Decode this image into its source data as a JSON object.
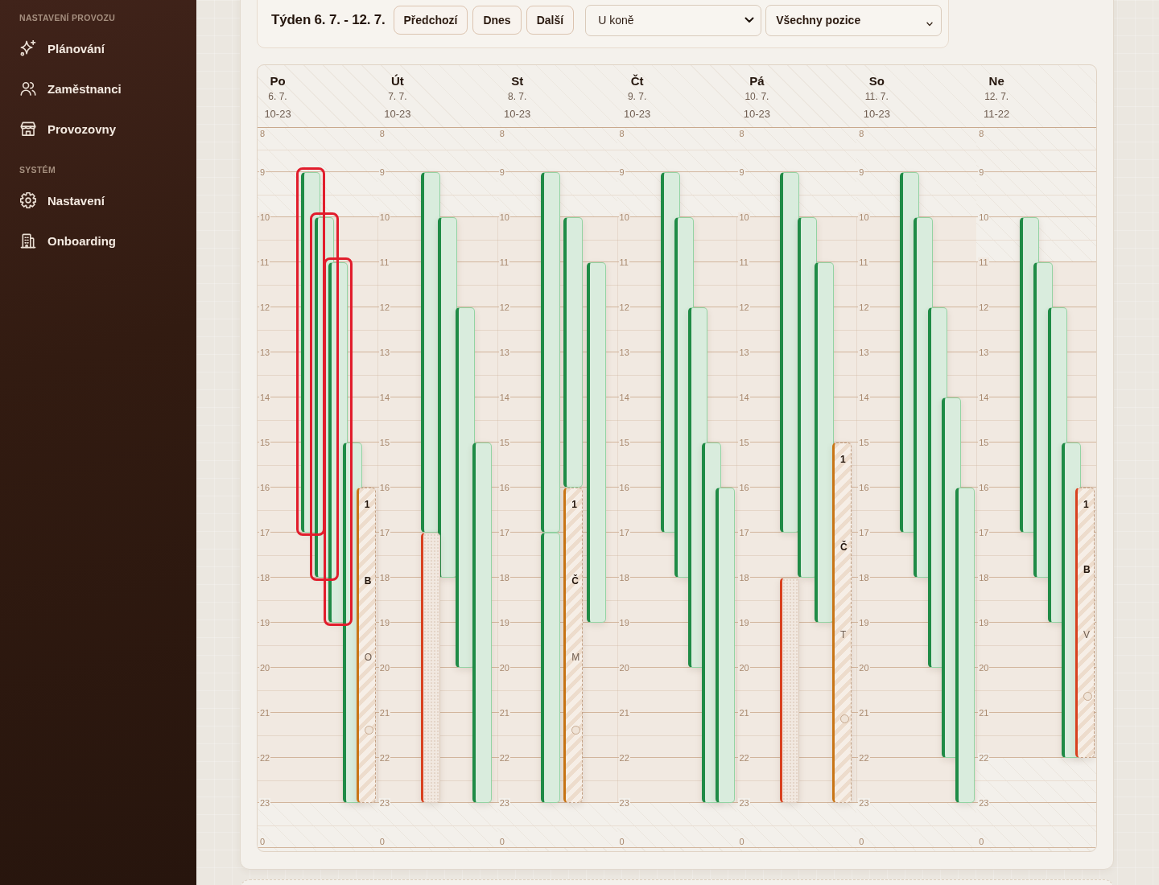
{
  "sidebar": {
    "sections": [
      {
        "heading": "NASTAVENÍ PROVOZU",
        "items": [
          {
            "label": "Plánování"
          },
          {
            "label": "Zaměstnanci"
          },
          {
            "label": "Provozovny"
          }
        ]
      },
      {
        "heading": "SYSTÉM",
        "items": [
          {
            "label": "Nastavení"
          },
          {
            "label": "Onboarding"
          }
        ]
      }
    ]
  },
  "toolbar": {
    "title": "Týden 6. 7. - 12. 7.",
    "buttons": [
      "Předchozí",
      "Dnes",
      "Další"
    ],
    "location_select": {
      "value": "U koně"
    },
    "position_select": {
      "value": "Všechny pozice"
    }
  },
  "days": [
    {
      "name": "Po",
      "date": "6. 7.",
      "hours": "10-23",
      "rows": [
        {
          "label": "8"
        },
        {
          "label": "9",
          "shifts": [
            {
              "kind": "assigned",
              "color": "#1f8b46",
              "highlighted": true,
              "slots": [
                {
                  "kind": "hour"
                },
                {
                  "kind": "hour"
                },
                {
                  "kind": "hour"
                },
                {
                  "kind": "hour"
                },
                {
                  "kind": "hour"
                },
                {
                  "kind": "hour"
                },
                {
                  "kind": "hour"
                },
                {
                  "kind": "hour"
                }
              ]
            }
          ]
        },
        {
          "label": "10",
          "shifts": [
            {
              "kind": "assigned",
              "color": "#1f8b46",
              "highlighted": true,
              "slots": [
                {
                  "kind": "hour"
                },
                {
                  "kind": "hour"
                },
                {
                  "kind": "hour"
                },
                {
                  "kind": "hour"
                },
                {
                  "kind": "hour"
                },
                {
                  "kind": "hour"
                },
                {
                  "kind": "hour"
                },
                {
                  "kind": "hour"
                }
              ]
            }
          ]
        },
        {
          "label": "11",
          "shifts": [
            {
              "kind": "assigned",
              "color": "#1f8b46",
              "highlighted": true,
              "slots": [
                {
                  "kind": "hour"
                },
                {
                  "kind": "hour"
                },
                {
                  "kind": "hour"
                },
                {
                  "kind": "hour"
                },
                {
                  "kind": "hour"
                },
                {
                  "kind": "hour"
                },
                {
                  "kind": "hour"
                },
                {
                  "kind": "hour"
                }
              ]
            }
          ]
        },
        {
          "label": "12"
        },
        {
          "label": "13"
        },
        {
          "label": "14"
        },
        {
          "label": "15",
          "shifts": [
            {
              "kind": "assigned",
              "color": "#1f8b46",
              "highlighted": false,
              "slots": [
                {
                  "kind": "hour"
                },
                {
                  "kind": "hour"
                },
                {
                  "kind": "hour"
                },
                {
                  "kind": "hour"
                },
                {
                  "kind": "hour"
                },
                {
                  "kind": "hour"
                },
                {
                  "kind": "hour"
                },
                {
                  "kind": "hour"
                }
              ]
            }
          ]
        },
        {
          "label": "16",
          "shifts": [
            {
              "kind": "open",
              "color": "#c97516",
              "highlighted": false,
              "slots": [
                {
                  "kind": "hour"
                },
                {
                  "kind": "hour"
                },
                {
                  "kind": "hour"
                },
                {
                  "kind": "hour"
                },
                {
                  "kind": "hour"
                },
                {
                  "kind": "hour"
                },
                {
                  "kind": "hour"
                }
              ],
              "time": "1",
              "title": "B",
              "subtitle": "O"
            }
          ]
        },
        {
          "label": "17"
        },
        {
          "label": "18"
        },
        {
          "label": "19"
        },
        {
          "label": "20"
        },
        {
          "label": "21"
        },
        {
          "label": "22"
        },
        {
          "label": "23"
        },
        {
          "label": "0"
        }
      ]
    },
    {
      "name": "Út",
      "date": "7. 7.",
      "hours": "10-23",
      "rows": [
        {
          "label": "8"
        },
        {
          "label": "9",
          "shifts": [
            {
              "kind": "assigned",
              "color": "#1f8b46",
              "highlighted": false,
              "slots": [
                {
                  "kind": "hour"
                },
                {
                  "kind": "hour"
                },
                {
                  "kind": "hour"
                },
                {
                  "kind": "hour"
                },
                {
                  "kind": "hour"
                },
                {
                  "kind": "hour"
                },
                {
                  "kind": "hour"
                },
                {
                  "kind": "hour"
                }
              ]
            }
          ]
        },
        {
          "label": "10",
          "shifts": [
            {
              "kind": "assigned",
              "color": "#1f8b46",
              "highlighted": false,
              "slots": [
                {
                  "kind": "hour"
                },
                {
                  "kind": "hour"
                },
                {
                  "kind": "hour"
                },
                {
                  "kind": "hour"
                },
                {
                  "kind": "hour"
                },
                {
                  "kind": "hour"
                },
                {
                  "kind": "hour"
                },
                {
                  "kind": "hour"
                }
              ]
            }
          ]
        },
        {
          "label": "11"
        },
        {
          "label": "12",
          "shifts": [
            {
              "kind": "assigned",
              "color": "#1f8b46",
              "highlighted": false,
              "slots": [
                {
                  "kind": "hour"
                },
                {
                  "kind": "hour"
                },
                {
                  "kind": "hour"
                },
                {
                  "kind": "hour"
                },
                {
                  "kind": "hour"
                },
                {
                  "kind": "hour"
                },
                {
                  "kind": "hour"
                },
                {
                  "kind": "hour"
                }
              ]
            }
          ]
        },
        {
          "label": "13"
        },
        {
          "label": "14"
        },
        {
          "label": "15",
          "shifts": [
            {
              "kind": "assigned",
              "color": "#1f8b46",
              "highlighted": false,
              "slots": [
                {
                  "kind": "hour"
                },
                {
                  "kind": "hour"
                },
                {
                  "kind": "hour"
                },
                {
                  "kind": "hour"
                },
                {
                  "kind": "hour"
                },
                {
                  "kind": "hour"
                },
                {
                  "kind": "hour"
                },
                {
                  "kind": "hour"
                }
              ]
            }
          ]
        },
        {
          "label": "16"
        },
        {
          "label": "17",
          "shifts": [
            {
              "kind": "unassigned",
              "color": "#d8411f",
              "highlighted": false,
              "slots": [
                {
                  "kind": "hour"
                },
                {
                  "kind": "hour"
                },
                {
                  "kind": "hour"
                },
                {
                  "kind": "hour"
                },
                {
                  "kind": "hour"
                },
                {
                  "kind": "hour"
                }
              ]
            }
          ]
        },
        {
          "label": "18"
        },
        {
          "label": "19"
        },
        {
          "label": "20"
        },
        {
          "label": "21"
        },
        {
          "label": "22"
        },
        {
          "label": "23"
        },
        {
          "label": "0"
        }
      ]
    },
    {
      "name": "St",
      "date": "8. 7.",
      "hours": "10-23",
      "rows": [
        {
          "label": "8"
        },
        {
          "label": "9",
          "shifts": [
            {
              "kind": "assigned",
              "color": "#1f8b46",
              "highlighted": false,
              "slots": [
                {
                  "kind": "hour"
                },
                {
                  "kind": "hour"
                },
                {
                  "kind": "hour"
                },
                {
                  "kind": "hour"
                },
                {
                  "kind": "hour"
                },
                {
                  "kind": "hour"
                },
                {
                  "kind": "hour"
                },
                {
                  "kind": "hour"
                }
              ]
            }
          ]
        },
        {
          "label": "10",
          "shifts": [
            {
              "kind": "assigned",
              "color": "#1f8b46",
              "highlighted": false,
              "slots": [
                {
                  "kind": "hour"
                },
                {
                  "kind": "hour"
                },
                {
                  "kind": "hour"
                },
                {
                  "kind": "hour"
                },
                {
                  "kind": "hour"
                },
                {
                  "kind": "hour"
                }
              ]
            }
          ]
        },
        {
          "label": "11",
          "shifts": [
            {
              "kind": "assigned",
              "color": "#1f8b46",
              "highlighted": false,
              "slots": [
                {
                  "kind": "hour"
                },
                {
                  "kind": "hour"
                },
                {
                  "kind": "hour"
                },
                {
                  "kind": "hour"
                },
                {
                  "kind": "hour"
                },
                {
                  "kind": "hour"
                },
                {
                  "kind": "hour"
                },
                {
                  "kind": "hour"
                }
              ]
            }
          ]
        },
        {
          "label": "12"
        },
        {
          "label": "13"
        },
        {
          "label": "14"
        },
        {
          "label": "15"
        },
        {
          "label": "16",
          "shifts": [
            {
              "kind": "open",
              "color": "#c97516",
              "highlighted": false,
              "slots": [
                {
                  "kind": "hour"
                },
                {
                  "kind": "hour"
                },
                {
                  "kind": "hour"
                },
                {
                  "kind": "hour"
                },
                {
                  "kind": "hour"
                },
                {
                  "kind": "hour"
                },
                {
                  "kind": "hour"
                }
              ],
              "time": "1",
              "title": "Č",
              "subtitle": "M"
            }
          ]
        },
        {
          "label": "17",
          "shifts": [
            {
              "kind": "assigned",
              "color": "#1f8b46",
              "highlighted": false,
              "slots": [
                {
                  "kind": "hour"
                },
                {
                  "kind": "hour"
                },
                {
                  "kind": "hour"
                },
                {
                  "kind": "hour"
                },
                {
                  "kind": "hour"
                },
                {
                  "kind": "hour"
                }
              ]
            }
          ]
        },
        {
          "label": "18"
        },
        {
          "label": "19"
        },
        {
          "label": "20"
        },
        {
          "label": "21"
        },
        {
          "label": "22"
        },
        {
          "label": "23"
        },
        {
          "label": "0"
        }
      ]
    },
    {
      "name": "Čt",
      "date": "9. 7.",
      "hours": "10-23",
      "rows": [
        {
          "label": "8"
        },
        {
          "label": "9",
          "shifts": [
            {
              "kind": "assigned",
              "color": "#1f8b46",
              "highlighted": false,
              "slots": [
                {
                  "kind": "hour"
                },
                {
                  "kind": "hour"
                },
                {
                  "kind": "hour"
                },
                {
                  "kind": "hour"
                },
                {
                  "kind": "hour"
                },
                {
                  "kind": "hour"
                },
                {
                  "kind": "hour"
                },
                {
                  "kind": "hour"
                }
              ]
            }
          ]
        },
        {
          "label": "10",
          "shifts": [
            {
              "kind": "assigned",
              "color": "#1f8b46",
              "highlighted": false,
              "slots": [
                {
                  "kind": "hour"
                },
                {
                  "kind": "hour"
                },
                {
                  "kind": "hour"
                },
                {
                  "kind": "hour"
                },
                {
                  "kind": "hour"
                },
                {
                  "kind": "hour"
                },
                {
                  "kind": "hour"
                },
                {
                  "kind": "hour"
                }
              ]
            }
          ]
        },
        {
          "label": "11"
        },
        {
          "label": "12",
          "shifts": [
            {
              "kind": "assigned",
              "color": "#1f8b46",
              "highlighted": false,
              "slots": [
                {
                  "kind": "hour"
                },
                {
                  "kind": "hour"
                },
                {
                  "kind": "hour"
                },
                {
                  "kind": "hour"
                },
                {
                  "kind": "hour"
                },
                {
                  "kind": "hour"
                },
                {
                  "kind": "hour"
                },
                {
                  "kind": "hour"
                }
              ]
            }
          ]
        },
        {
          "label": "13"
        },
        {
          "label": "14"
        },
        {
          "label": "15",
          "shifts": [
            {
              "kind": "assigned",
              "color": "#1f8b46",
              "highlighted": false,
              "slots": [
                {
                  "kind": "hour"
                },
                {
                  "kind": "hour"
                },
                {
                  "kind": "hour"
                },
                {
                  "kind": "hour"
                },
                {
                  "kind": "hour"
                },
                {
                  "kind": "hour"
                },
                {
                  "kind": "hour"
                },
                {
                  "kind": "hour"
                }
              ]
            }
          ]
        },
        {
          "label": "16",
          "shifts": [
            {
              "kind": "assigned",
              "color": "#1f8b46",
              "highlighted": false,
              "slots": [
                {
                  "kind": "hour"
                },
                {
                  "kind": "hour"
                },
                {
                  "kind": "hour"
                },
                {
                  "kind": "hour"
                },
                {
                  "kind": "hour"
                },
                {
                  "kind": "hour"
                },
                {
                  "kind": "hour"
                }
              ]
            }
          ]
        },
        {
          "label": "17"
        },
        {
          "label": "18"
        },
        {
          "label": "19"
        },
        {
          "label": "20"
        },
        {
          "label": "21"
        },
        {
          "label": "22"
        },
        {
          "label": "23"
        },
        {
          "label": "0"
        }
      ]
    },
    {
      "name": "Pá",
      "date": "10. 7.",
      "hours": "10-23",
      "rows": [
        {
          "label": "8"
        },
        {
          "label": "9",
          "shifts": [
            {
              "kind": "assigned",
              "color": "#1f8b46",
              "highlighted": false,
              "slots": [
                {
                  "kind": "hour"
                },
                {
                  "kind": "hour"
                },
                {
                  "kind": "hour"
                },
                {
                  "kind": "hour"
                },
                {
                  "kind": "hour"
                },
                {
                  "kind": "hour"
                },
                {
                  "kind": "hour"
                },
                {
                  "kind": "hour"
                }
              ]
            }
          ]
        },
        {
          "label": "10",
          "shifts": [
            {
              "kind": "assigned",
              "color": "#1f8b46",
              "highlighted": false,
              "slots": [
                {
                  "kind": "hour"
                },
                {
                  "kind": "hour"
                },
                {
                  "kind": "hour"
                },
                {
                  "kind": "hour"
                },
                {
                  "kind": "hour"
                },
                {
                  "kind": "hour"
                },
                {
                  "kind": "hour"
                },
                {
                  "kind": "hour"
                }
              ]
            }
          ]
        },
        {
          "label": "11",
          "shifts": [
            {
              "kind": "assigned",
              "color": "#1f8b46",
              "highlighted": false,
              "slots": [
                {
                  "kind": "hour"
                },
                {
                  "kind": "hour"
                },
                {
                  "kind": "hour"
                },
                {
                  "kind": "hour"
                },
                {
                  "kind": "hour"
                },
                {
                  "kind": "hour"
                },
                {
                  "kind": "hour"
                },
                {
                  "kind": "hour"
                }
              ]
            }
          ]
        },
        {
          "label": "12"
        },
        {
          "label": "13"
        },
        {
          "label": "14"
        },
        {
          "label": "15",
          "shifts": [
            {
              "kind": "open",
              "color": "#c97516",
              "highlighted": false,
              "slots": [
                {
                  "kind": "hour"
                },
                {
                  "kind": "hour"
                },
                {
                  "kind": "hour"
                },
                {
                  "kind": "hour"
                },
                {
                  "kind": "hour"
                },
                {
                  "kind": "hour"
                },
                {
                  "kind": "hour"
                },
                {
                  "kind": "hour"
                }
              ],
              "time": "1",
              "title": "Č",
              "subtitle": "T"
            }
          ]
        },
        {
          "label": "16"
        },
        {
          "label": "17"
        },
        {
          "label": "18",
          "shifts": [
            {
              "kind": "unassigned",
              "color": "#d8411f",
              "highlighted": false,
              "slots": [
                {
                  "kind": "hour"
                },
                {
                  "kind": "hour"
                },
                {
                  "kind": "hour"
                },
                {
                  "kind": "hour"
                },
                {
                  "kind": "hour"
                }
              ]
            }
          ]
        },
        {
          "label": "19"
        },
        {
          "label": "20"
        },
        {
          "label": "21"
        },
        {
          "label": "22"
        },
        {
          "label": "23"
        },
        {
          "label": "0"
        }
      ]
    },
    {
      "name": "So",
      "date": "11. 7.",
      "hours": "10-23",
      "rows": [
        {
          "label": "8"
        },
        {
          "label": "9",
          "shifts": [
            {
              "kind": "assigned",
              "color": "#1f8b46",
              "highlighted": false,
              "slots": [
                {
                  "kind": "hour"
                },
                {
                  "kind": "hour"
                },
                {
                  "kind": "hour"
                },
                {
                  "kind": "hour"
                },
                {
                  "kind": "hour"
                },
                {
                  "kind": "hour"
                },
                {
                  "kind": "hour"
                },
                {
                  "kind": "hour"
                }
              ]
            }
          ]
        },
        {
          "label": "10",
          "shifts": [
            {
              "kind": "assigned",
              "color": "#1f8b46",
              "highlighted": false,
              "slots": [
                {
                  "kind": "hour"
                },
                {
                  "kind": "hour"
                },
                {
                  "kind": "hour"
                },
                {
                  "kind": "hour"
                },
                {
                  "kind": "hour"
                },
                {
                  "kind": "hour"
                },
                {
                  "kind": "hour"
                },
                {
                  "kind": "hour"
                }
              ]
            }
          ]
        },
        {
          "label": "11"
        },
        {
          "label": "12",
          "shifts": [
            {
              "kind": "assigned",
              "color": "#1f8b46",
              "highlighted": false,
              "slots": [
                {
                  "kind": "hour"
                },
                {
                  "kind": "hour"
                },
                {
                  "kind": "hour"
                },
                {
                  "kind": "hour"
                },
                {
                  "kind": "hour"
                },
                {
                  "kind": "hour"
                },
                {
                  "kind": "hour"
                },
                {
                  "kind": "hour"
                }
              ]
            }
          ]
        },
        {
          "label": "13"
        },
        {
          "label": "14",
          "shifts": [
            {
              "kind": "assigned",
              "color": "#1f8b46",
              "highlighted": false,
              "slots": [
                {
                  "kind": "hour"
                },
                {
                  "kind": "hour"
                },
                {
                  "kind": "hour"
                },
                {
                  "kind": "hour"
                },
                {
                  "kind": "hour"
                },
                {
                  "kind": "hour"
                },
                {
                  "kind": "hour"
                },
                {
                  "kind": "hour"
                }
              ]
            }
          ]
        },
        {
          "label": "15"
        },
        {
          "label": "16",
          "shifts": [
            {
              "kind": "assigned",
              "color": "#1f8b46",
              "highlighted": false,
              "slots": [
                {
                  "kind": "hour"
                },
                {
                  "kind": "hour"
                },
                {
                  "kind": "hour"
                },
                {
                  "kind": "hour"
                },
                {
                  "kind": "hour"
                },
                {
                  "kind": "hour"
                },
                {
                  "kind": "hour"
                }
              ]
            }
          ]
        },
        {
          "label": "17"
        },
        {
          "label": "18"
        },
        {
          "label": "19"
        },
        {
          "label": "20"
        },
        {
          "label": "21"
        },
        {
          "label": "22"
        },
        {
          "label": "23"
        },
        {
          "label": "0"
        }
      ]
    },
    {
      "name": "Ne",
      "date": "12. 7.",
      "hours": "11-22",
      "rows": [
        {
          "label": "8"
        },
        {
          "label": "9"
        },
        {
          "label": "10",
          "shifts": [
            {
              "kind": "assigned",
              "color": "#1f8b46",
              "highlighted": false,
              "slots": [
                {
                  "kind": "hour"
                },
                {
                  "kind": "hour"
                },
                {
                  "kind": "hour"
                },
                {
                  "kind": "hour"
                },
                {
                  "kind": "hour"
                },
                {
                  "kind": "hour"
                },
                {
                  "kind": "hour"
                }
              ]
            }
          ]
        },
        {
          "label": "11",
          "shifts": [
            {
              "kind": "assigned",
              "color": "#1f8b46",
              "highlighted": false,
              "slots": [
                {
                  "kind": "hour"
                },
                {
                  "kind": "hour"
                },
                {
                  "kind": "hour"
                },
                {
                  "kind": "hour"
                },
                {
                  "kind": "hour"
                },
                {
                  "kind": "hour"
                },
                {
                  "kind": "hour"
                }
              ]
            }
          ]
        },
        {
          "label": "12",
          "shifts": [
            {
              "kind": "assigned",
              "color": "#1f8b46",
              "highlighted": false,
              "slots": [
                {
                  "kind": "hour"
                },
                {
                  "kind": "hour"
                },
                {
                  "kind": "hour"
                },
                {
                  "kind": "hour"
                },
                {
                  "kind": "hour"
                },
                {
                  "kind": "hour"
                },
                {
                  "kind": "hour"
                }
              ]
            }
          ]
        },
        {
          "label": "13"
        },
        {
          "label": "14"
        },
        {
          "label": "15",
          "shifts": [
            {
              "kind": "assigned",
              "color": "#1f8b46",
              "highlighted": false,
              "slots": [
                {
                  "kind": "hour"
                },
                {
                  "kind": "hour"
                },
                {
                  "kind": "hour"
                },
                {
                  "kind": "hour"
                },
                {
                  "kind": "hour"
                },
                {
                  "kind": "hour"
                },
                {
                  "kind": "hour"
                }
              ]
            }
          ]
        },
        {
          "label": "16",
          "shifts": [
            {
              "kind": "open",
              "color": "#d8411f",
              "highlighted": false,
              "slots": [
                {
                  "kind": "hour"
                },
                {
                  "kind": "hour"
                },
                {
                  "kind": "hour"
                },
                {
                  "kind": "hour"
                },
                {
                  "kind": "hour"
                },
                {
                  "kind": "hour"
                }
              ],
              "time": "1",
              "title": "B",
              "subtitle": "V"
            }
          ]
        },
        {
          "label": "17"
        },
        {
          "label": "18"
        },
        {
          "label": "19"
        },
        {
          "label": "20"
        },
        {
          "label": "21"
        },
        {
          "label": "22"
        },
        {
          "label": "23"
        },
        {
          "label": "0"
        }
      ]
    }
  ]
}
